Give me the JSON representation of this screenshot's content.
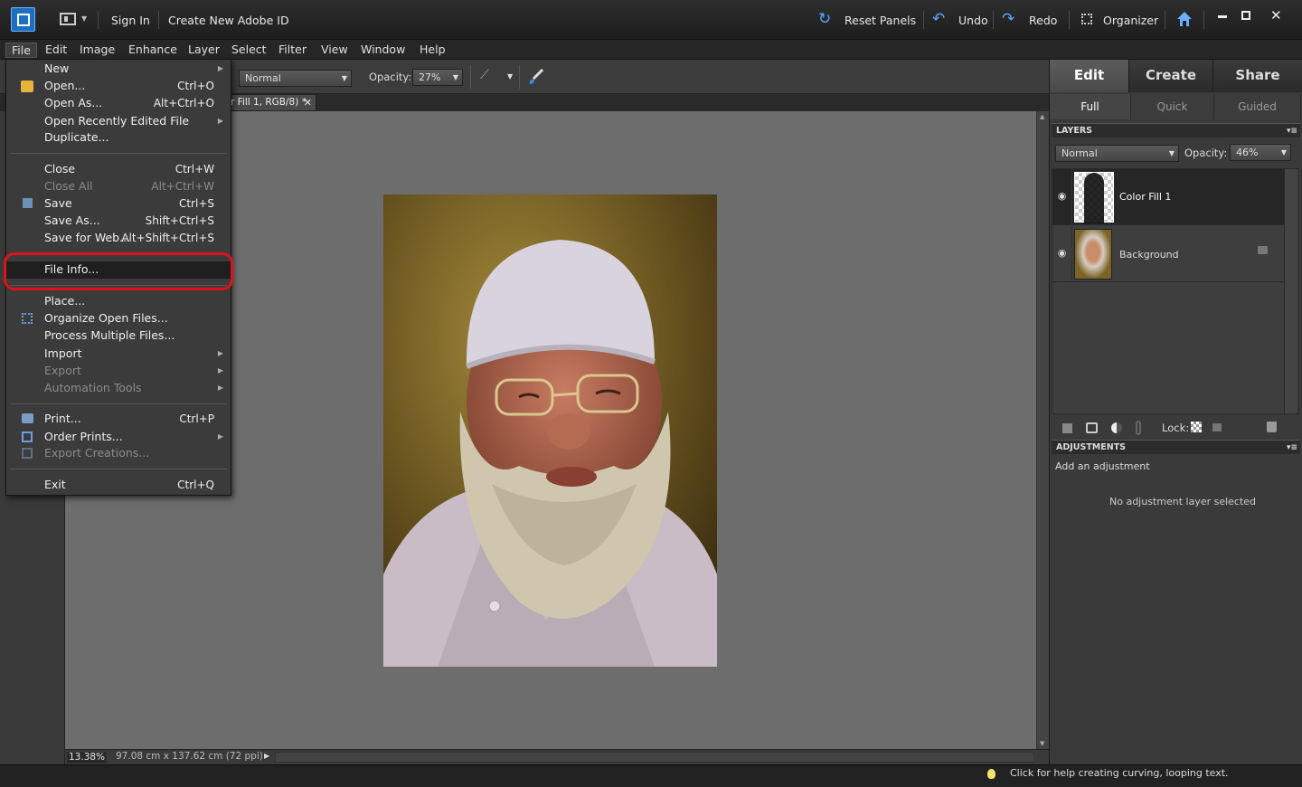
{
  "titlebar": {
    "sign_in": "Sign In",
    "create_id": "Create New Adobe ID",
    "reset_panels": "Reset Panels",
    "undo": "Undo",
    "redo": "Redo",
    "organizer": "Organizer"
  },
  "menubar": [
    "File",
    "Edit",
    "Image",
    "Enhance",
    "Layer",
    "Select",
    "Filter",
    "View",
    "Window",
    "Help"
  ],
  "options": {
    "mode": "Normal",
    "opacity_label": "Opacity:",
    "opacity_value": "27%"
  },
  "doc_tab": "r Fill 1, RGB/8) *",
  "file_menu": {
    "new": {
      "label": "New"
    },
    "open": {
      "label": "Open...",
      "shortcut": "Ctrl+O"
    },
    "open_as": {
      "label": "Open As...",
      "shortcut": "Alt+Ctrl+O"
    },
    "open_recent": {
      "label": "Open Recently Edited File"
    },
    "duplicate": {
      "label": "Duplicate..."
    },
    "close": {
      "label": "Close",
      "shortcut": "Ctrl+W"
    },
    "close_all": {
      "label": "Close All",
      "shortcut": "Alt+Ctrl+W"
    },
    "save": {
      "label": "Save",
      "shortcut": "Ctrl+S"
    },
    "save_as": {
      "label": "Save As...",
      "shortcut": "Shift+Ctrl+S"
    },
    "save_web": {
      "label": "Save for Web...",
      "shortcut": "Alt+Shift+Ctrl+S"
    },
    "file_info": {
      "label": "File Info..."
    },
    "place": {
      "label": "Place..."
    },
    "organize": {
      "label": "Organize Open Files..."
    },
    "process": {
      "label": "Process Multiple Files..."
    },
    "import": {
      "label": "Import"
    },
    "export": {
      "label": "Export"
    },
    "automation": {
      "label": "Automation Tools"
    },
    "print": {
      "label": "Print...",
      "shortcut": "Ctrl+P"
    },
    "order": {
      "label": "Order Prints..."
    },
    "export_creations": {
      "label": "Export Creations..."
    },
    "exit": {
      "label": "Exit",
      "shortcut": "Ctrl+Q"
    }
  },
  "panel": {
    "tabs": [
      "Edit",
      "Create",
      "Share"
    ],
    "subtabs": [
      "Full",
      "Quick",
      "Guided"
    ],
    "layers_header": "LAYERS",
    "blend_mode": "Normal",
    "opacity_label": "Opacity:",
    "opacity_value": "46%",
    "layers": [
      {
        "name": "Color Fill 1"
      },
      {
        "name": "Background"
      }
    ],
    "lock_label": "Lock:",
    "adjustments_header": "ADJUSTMENTS",
    "add_adjustment": "Add an adjustment",
    "no_adjustment": "No adjustment layer selected"
  },
  "status": {
    "zoom": "13.38%",
    "doc_size": "97.08 cm x 137.62 cm (72 ppi)"
  },
  "hint": "Click for help creating curving, looping text."
}
